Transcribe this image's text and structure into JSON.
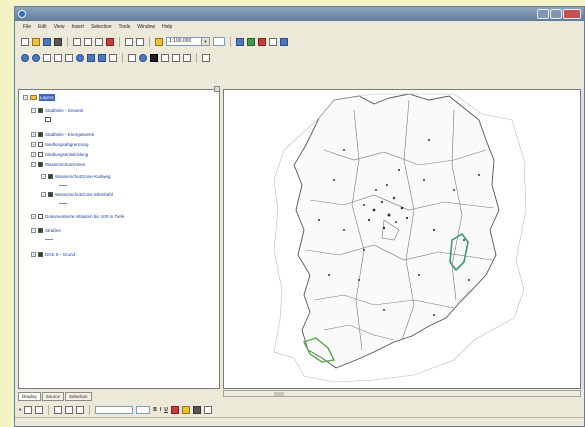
{
  "window": {
    "title": ""
  },
  "menu": [
    "File",
    "Edit",
    "View",
    "Insert",
    "Selection",
    "Tools",
    "Window",
    "Help"
  ],
  "toolbar": {
    "scale": "1:100.000"
  },
  "toc": {
    "root": "Layers",
    "layers": [
      {
        "label": "Stadtteile - Gesamt",
        "checked": true
      },
      {
        "label": "Stadtteile - Energiewerte",
        "checked": true
      },
      {
        "label": "Siedlungsabgrenzung",
        "checked": false
      },
      {
        "label": "Siedlungsentwicklung",
        "checked": false
      },
      {
        "label": "Wasserschutzzonen",
        "checked": true
      },
      {
        "label": "Wasserschutzzone Karlweg",
        "checked": true
      },
      {
        "label": "Wasserschutzzone Eltenbühl",
        "checked": true
      },
      {
        "label": "Dokumentierte Altlasten bis 100 m Tiefe",
        "checked": false
      },
      {
        "label": "Straßen",
        "checked": true
      },
      {
        "label": "DGK 5 - Grund",
        "checked": true
      }
    ]
  },
  "tabs": [
    "Display",
    "Source",
    "Selection"
  ],
  "colors": {
    "desktop": "#f4f3c6",
    "chrome": "#ece9d8",
    "titlebar": "#6a86a6",
    "selection": "#3b67c4",
    "water_zone": "#3c9a78"
  },
  "statusbar": {
    "coordinates": ""
  }
}
